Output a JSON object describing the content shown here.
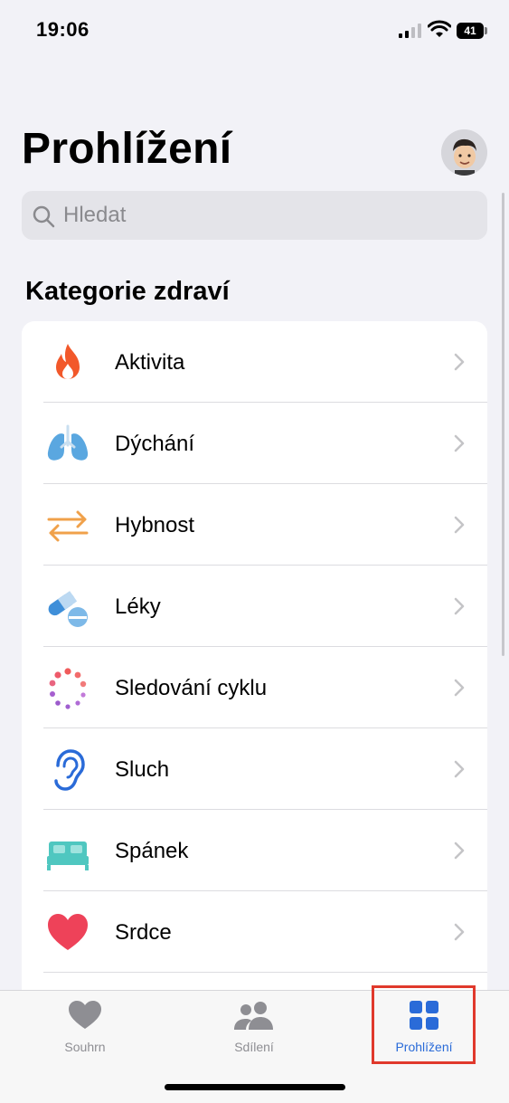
{
  "status_bar": {
    "time": "19:06",
    "battery": "41"
  },
  "page": {
    "title": "Prohlížení"
  },
  "search": {
    "placeholder": "Hledat",
    "value": ""
  },
  "section": {
    "title": "Kategorie zdraví"
  },
  "categories": [
    {
      "label": "Aktivita",
      "icon": "flame-icon"
    },
    {
      "label": "Dýchání",
      "icon": "lungs-icon"
    },
    {
      "label": "Hybnost",
      "icon": "mobility-arrows-icon"
    },
    {
      "label": "Léky",
      "icon": "pills-icon"
    },
    {
      "label": "Sledování cyklu",
      "icon": "cycle-tracking-icon"
    },
    {
      "label": "Sluch",
      "icon": "ear-icon"
    },
    {
      "label": "Spánek",
      "icon": "bed-icon"
    },
    {
      "label": "Srdce",
      "icon": "heart-icon"
    }
  ],
  "tab_bar": {
    "tabs": [
      {
        "label": "Souhrn",
        "icon": "heart-icon"
      },
      {
        "label": "Sdílení",
        "icon": "people-icon"
      },
      {
        "label": "Prohlížení",
        "icon": "grid-icon",
        "active": true
      }
    ]
  },
  "colors": {
    "accent": "#2a6bd8",
    "highlight": "#e0392c"
  }
}
